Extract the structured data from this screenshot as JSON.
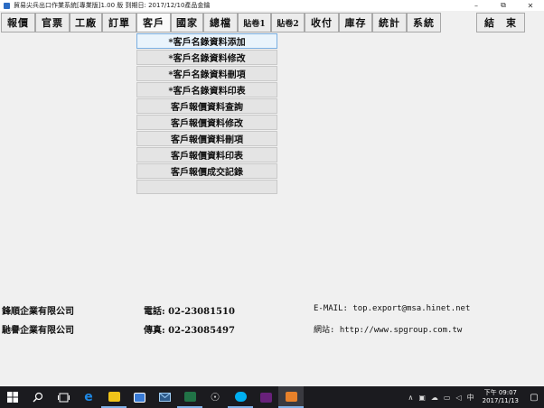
{
  "window": {
    "title": "貿易尖兵出口作業系統[專業版]1.00 版 到期日: 2017/12/10產品金鑰"
  },
  "menu": {
    "items": [
      "報價",
      "官票",
      "工廠",
      "訂單",
      "客戶",
      "國家",
      "總檔",
      "貼卷1",
      "貼卷2",
      "收付",
      "庫存",
      "統計",
      "系統"
    ],
    "exit_label": "結　束"
  },
  "dropdown": {
    "items": [
      "*客戶名錄資料添加",
      "*客戶名錄資料修改",
      "*客戶名錄資料刪項",
      "*客戶名錄資料印表",
      "客戶報價資料查詢",
      "客戶報價資料修改",
      "客戶報價資料刪項",
      "客戶報價資料印表",
      "客戶報價成交記錄",
      ""
    ]
  },
  "company": {
    "name1": "鋒順企業有限公司",
    "phone": "電話: 02-23081510",
    "email": "E-MAIL: top.export@msa.hinet.net",
    "name2": "馳譽企業有限公司",
    "fax": "傳真: 02-23085497",
    "website": "網站: http://www.spgroup.com.tw"
  },
  "taskbar": {
    "time": "下午 09:07",
    "date": "2017/11/13",
    "ime": "中",
    "colors": {
      "edge": "#1e88e5",
      "explorer": "#f0c419",
      "store": "#3a7bd5",
      "excel": "#217346",
      "skype": "#00aff0",
      "vs": "#68217a",
      "app": "#e8812a"
    }
  },
  "colors": {
    "highlight_border": "#7aaee0",
    "highlight_bg": "#eaf4fc"
  }
}
